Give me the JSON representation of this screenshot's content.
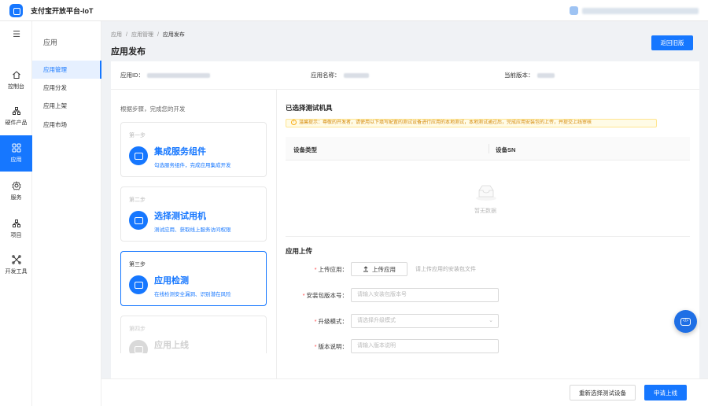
{
  "topbar": {
    "brand": "支付宝开放平台-IoT"
  },
  "rail": {
    "items": [
      {
        "label": "控制台",
        "icon": "home-icon"
      },
      {
        "label": "硬件产品",
        "icon": "hardware-icon"
      },
      {
        "label": "应用",
        "icon": "app-grid-icon",
        "active": true
      },
      {
        "label": "服务",
        "icon": "service-gear-icon"
      },
      {
        "label": "项目",
        "icon": "project-icon"
      },
      {
        "label": "开发工具",
        "icon": "dev-tools-icon"
      }
    ]
  },
  "submenu": {
    "title": "应用",
    "items": [
      {
        "label": "应用管理",
        "active": true
      },
      {
        "label": "应用分发"
      },
      {
        "label": "应用上架"
      },
      {
        "label": "应用市场"
      }
    ]
  },
  "breadcrumb": {
    "items": [
      "应用",
      "应用管理",
      "应用发布"
    ]
  },
  "page": {
    "title": "应用发布",
    "back_button": "返回旧版"
  },
  "info": {
    "app_id_label": "应用ID：",
    "app_name_label": "应用名称：",
    "version_label": "当前版本："
  },
  "steps": {
    "hint": "根据步骤，完成您的开发",
    "items": [
      {
        "num": "第一步",
        "name": "集成服务组件",
        "desc": "勾选服务组件，完成应用集成开发"
      },
      {
        "num": "第二步",
        "name": "选择测试用机",
        "desc": "测试应用、获取线上服务访问权限"
      },
      {
        "num": "第三步",
        "name": "应用检测",
        "desc": "在线检测安全漏洞、识别潜在风险"
      },
      {
        "num": "第四步",
        "name": "应用上线",
        "desc": ""
      }
    ]
  },
  "devices": {
    "title": "已选择测试机具",
    "notice": "温馨提示：尊敬的开发者，请使用以下填写配置的测试设备进行应用的本地测试，本地测试通过后，完成应用安装包的上传，并提交上线审核",
    "columns": [
      "设备类型",
      "设备SN"
    ],
    "empty_text": "暂无数据"
  },
  "upload": {
    "title": "应用上传",
    "package_label": "上传应用：",
    "upload_button": "上传应用",
    "upload_hint": "请上传应用的安装包文件",
    "version_label": "安装包版本号：",
    "version_placeholder": "请输入安装包版本号",
    "mode_label": "升级模式：",
    "mode_placeholder": "请选择升级模式",
    "desc_label": "版本说明：",
    "desc_placeholder": "请输入版本说明"
  },
  "footer": {
    "reselect_button": "重新选择测试设备",
    "submit_button": "申请上线"
  },
  "colors": {
    "primary": "#1677ff",
    "required": "#ff4d4f",
    "notice_bg": "#fffbe6"
  }
}
